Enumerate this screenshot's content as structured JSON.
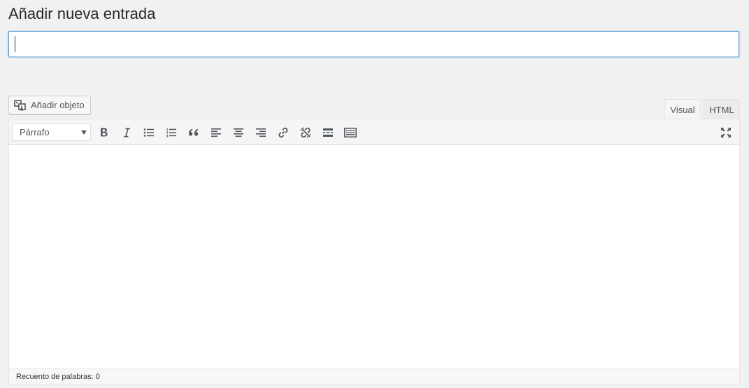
{
  "page": {
    "title": "Añadir nueva entrada"
  },
  "title_field": {
    "value": "",
    "placeholder": ""
  },
  "media": {
    "button_label": "Añadir objeto",
    "icon": "media-icon"
  },
  "editor_tabs": [
    {
      "label": "Visual",
      "active": true
    },
    {
      "label": "HTML",
      "active": false
    }
  ],
  "toolbar": {
    "format_select": {
      "selected": "Párrafo"
    },
    "buttons": [
      {
        "name": "bold",
        "icon": "bold-icon"
      },
      {
        "name": "italic",
        "icon": "italic-icon"
      },
      {
        "name": "bullet-list",
        "icon": "bullet-list-icon"
      },
      {
        "name": "numbered-list",
        "icon": "numbered-list-icon"
      },
      {
        "name": "blockquote",
        "icon": "blockquote-icon"
      },
      {
        "name": "align-left",
        "icon": "align-left-icon"
      },
      {
        "name": "align-center",
        "icon": "align-center-icon"
      },
      {
        "name": "align-right",
        "icon": "align-right-icon"
      },
      {
        "name": "insert-link",
        "icon": "link-icon"
      },
      {
        "name": "remove-link",
        "icon": "unlink-icon"
      },
      {
        "name": "read-more",
        "icon": "read-more-icon"
      },
      {
        "name": "toolbar-toggle",
        "icon": "keyboard-icon"
      },
      {
        "name": "fullscreen",
        "icon": "fullscreen-icon"
      }
    ]
  },
  "status_bar": {
    "word_count": "Recuento de palabras: 0"
  },
  "colors": {
    "focus_border": "#5b9dd9",
    "background": "#f1f1f1",
    "toolbar_bg": "#f5f5f5",
    "icon": "#555555"
  }
}
